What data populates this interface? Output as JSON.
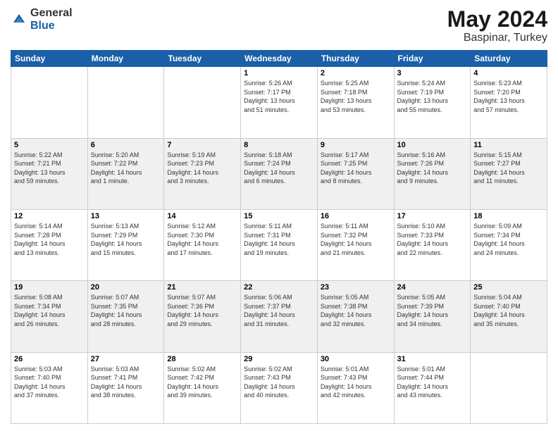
{
  "header": {
    "logo_general": "General",
    "logo_blue": "Blue",
    "month": "May 2024",
    "location": "Baspinar, Turkey"
  },
  "days_of_week": [
    "Sunday",
    "Monday",
    "Tuesday",
    "Wednesday",
    "Thursday",
    "Friday",
    "Saturday"
  ],
  "weeks": [
    [
      {
        "day": "",
        "info": ""
      },
      {
        "day": "",
        "info": ""
      },
      {
        "day": "",
        "info": ""
      },
      {
        "day": "1",
        "info": "Sunrise: 5:26 AM\nSunset: 7:17 PM\nDaylight: 13 hours\nand 51 minutes."
      },
      {
        "day": "2",
        "info": "Sunrise: 5:25 AM\nSunset: 7:18 PM\nDaylight: 13 hours\nand 53 minutes."
      },
      {
        "day": "3",
        "info": "Sunrise: 5:24 AM\nSunset: 7:19 PM\nDaylight: 13 hours\nand 55 minutes."
      },
      {
        "day": "4",
        "info": "Sunrise: 5:23 AM\nSunset: 7:20 PM\nDaylight: 13 hours\nand 57 minutes."
      }
    ],
    [
      {
        "day": "5",
        "info": "Sunrise: 5:22 AM\nSunset: 7:21 PM\nDaylight: 13 hours\nand 59 minutes."
      },
      {
        "day": "6",
        "info": "Sunrise: 5:20 AM\nSunset: 7:22 PM\nDaylight: 14 hours\nand 1 minute."
      },
      {
        "day": "7",
        "info": "Sunrise: 5:19 AM\nSunset: 7:23 PM\nDaylight: 14 hours\nand 3 minutes."
      },
      {
        "day": "8",
        "info": "Sunrise: 5:18 AM\nSunset: 7:24 PM\nDaylight: 14 hours\nand 6 minutes."
      },
      {
        "day": "9",
        "info": "Sunrise: 5:17 AM\nSunset: 7:25 PM\nDaylight: 14 hours\nand 8 minutes."
      },
      {
        "day": "10",
        "info": "Sunrise: 5:16 AM\nSunset: 7:26 PM\nDaylight: 14 hours\nand 9 minutes."
      },
      {
        "day": "11",
        "info": "Sunrise: 5:15 AM\nSunset: 7:27 PM\nDaylight: 14 hours\nand 11 minutes."
      }
    ],
    [
      {
        "day": "12",
        "info": "Sunrise: 5:14 AM\nSunset: 7:28 PM\nDaylight: 14 hours\nand 13 minutes."
      },
      {
        "day": "13",
        "info": "Sunrise: 5:13 AM\nSunset: 7:29 PM\nDaylight: 14 hours\nand 15 minutes."
      },
      {
        "day": "14",
        "info": "Sunrise: 5:12 AM\nSunset: 7:30 PM\nDaylight: 14 hours\nand 17 minutes."
      },
      {
        "day": "15",
        "info": "Sunrise: 5:11 AM\nSunset: 7:31 PM\nDaylight: 14 hours\nand 19 minutes."
      },
      {
        "day": "16",
        "info": "Sunrise: 5:11 AM\nSunset: 7:32 PM\nDaylight: 14 hours\nand 21 minutes."
      },
      {
        "day": "17",
        "info": "Sunrise: 5:10 AM\nSunset: 7:33 PM\nDaylight: 14 hours\nand 22 minutes."
      },
      {
        "day": "18",
        "info": "Sunrise: 5:09 AM\nSunset: 7:34 PM\nDaylight: 14 hours\nand 24 minutes."
      }
    ],
    [
      {
        "day": "19",
        "info": "Sunrise: 5:08 AM\nSunset: 7:34 PM\nDaylight: 14 hours\nand 26 minutes."
      },
      {
        "day": "20",
        "info": "Sunrise: 5:07 AM\nSunset: 7:35 PM\nDaylight: 14 hours\nand 28 minutes."
      },
      {
        "day": "21",
        "info": "Sunrise: 5:07 AM\nSunset: 7:36 PM\nDaylight: 14 hours\nand 29 minutes."
      },
      {
        "day": "22",
        "info": "Sunrise: 5:06 AM\nSunset: 7:37 PM\nDaylight: 14 hours\nand 31 minutes."
      },
      {
        "day": "23",
        "info": "Sunrise: 5:05 AM\nSunset: 7:38 PM\nDaylight: 14 hours\nand 32 minutes."
      },
      {
        "day": "24",
        "info": "Sunrise: 5:05 AM\nSunset: 7:39 PM\nDaylight: 14 hours\nand 34 minutes."
      },
      {
        "day": "25",
        "info": "Sunrise: 5:04 AM\nSunset: 7:40 PM\nDaylight: 14 hours\nand 35 minutes."
      }
    ],
    [
      {
        "day": "26",
        "info": "Sunrise: 5:03 AM\nSunset: 7:40 PM\nDaylight: 14 hours\nand 37 minutes."
      },
      {
        "day": "27",
        "info": "Sunrise: 5:03 AM\nSunset: 7:41 PM\nDaylight: 14 hours\nand 38 minutes."
      },
      {
        "day": "28",
        "info": "Sunrise: 5:02 AM\nSunset: 7:42 PM\nDaylight: 14 hours\nand 39 minutes."
      },
      {
        "day": "29",
        "info": "Sunrise: 5:02 AM\nSunset: 7:43 PM\nDaylight: 14 hours\nand 40 minutes."
      },
      {
        "day": "30",
        "info": "Sunrise: 5:01 AM\nSunset: 7:43 PM\nDaylight: 14 hours\nand 42 minutes."
      },
      {
        "day": "31",
        "info": "Sunrise: 5:01 AM\nSunset: 7:44 PM\nDaylight: 14 hours\nand 43 minutes."
      },
      {
        "day": "",
        "info": ""
      }
    ]
  ]
}
